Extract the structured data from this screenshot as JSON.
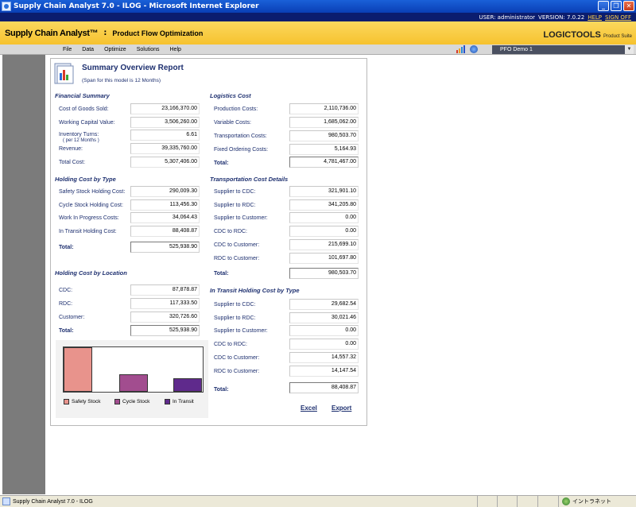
{
  "window": {
    "title": "Supply Chain Analyst 7.0 - ILOG - Microsoft Internet Explorer",
    "buttons": [
      "_",
      "❐",
      "✕"
    ]
  },
  "userbar": {
    "user_text": "USER: administrator",
    "version_text": "VERSION: 7.0.22",
    "help": "HELP",
    "signoff": "SIGN OFF"
  },
  "banner": {
    "brand": "Supply Chain Analyst™",
    "separator": ":",
    "product": "Product Flow Optimization",
    "logo": "LOGICTOOLS",
    "logo_suffix": "Product Suite"
  },
  "menu": {
    "items": [
      "File",
      "Data",
      "Optimize",
      "Solutions",
      "Help"
    ],
    "scenario": "PFO Demo 1"
  },
  "report": {
    "title": "Summary Overview Report",
    "span": "(Span for this model is 12 Months)",
    "financial": {
      "heading": "Financial Summary",
      "rows": [
        {
          "label": "Cost of Goods Sold:",
          "value": "23,166,370.00"
        },
        {
          "label": "Working Capital Value:",
          "value": "3,506,260.00"
        },
        {
          "label": "Inventory Turns:",
          "sub": "( per 12 Months )",
          "value": "6.61"
        },
        {
          "label": "Revenue:",
          "value": "39,335,760.00"
        },
        {
          "label": "Total Cost:",
          "value": "5,307,406.00"
        }
      ]
    },
    "logistics": {
      "heading": "Logistics Cost",
      "rows": [
        {
          "label": "Production Costs:",
          "value": "2,110,736.00"
        },
        {
          "label": "Variable Costs:",
          "value": "1,685,062.00"
        },
        {
          "label": "Transportation Costs:",
          "value": "980,503.70"
        },
        {
          "label": "Fixed Ordering Costs:",
          "value": "5,164.93"
        }
      ],
      "total_label": "Total:",
      "total": "4,781,467.00"
    },
    "holding_type": {
      "heading": "Holding Cost by Type",
      "rows": [
        {
          "label": "Safety Stock Holding Cost:",
          "value": "290,009.30"
        },
        {
          "label": "Cycle Stock Holding Cost:",
          "value": "113,456.30"
        },
        {
          "label": "Work In Progress Costs:",
          "value": "34,064.43"
        },
        {
          "label": "In Transit Holding Cost:",
          "value": "88,408.87"
        }
      ],
      "total_label": "Total:",
      "total": "525,938.90"
    },
    "transport": {
      "heading": "Transportation Cost Details",
      "rows": [
        {
          "label": "Supplier to CDC:",
          "value": "321,901.10"
        },
        {
          "label": "Supplier to RDC:",
          "value": "341,205.80"
        },
        {
          "label": "Supplier to Customer:",
          "value": "0.00"
        },
        {
          "label": "CDC to RDC:",
          "value": "0.00"
        },
        {
          "label": "CDC to Customer:",
          "value": "215,699.10"
        },
        {
          "label": "RDC to Customer:",
          "value": "101,697.80"
        }
      ],
      "total_label": "Total:",
      "total": "980,503.70"
    },
    "holding_location": {
      "heading": "Holding Cost by Location",
      "rows": [
        {
          "label": "CDC:",
          "value": "87,878.87"
        },
        {
          "label": "RDC:",
          "value": "117,333.50"
        },
        {
          "label": "Customer:",
          "value": "320,726.60"
        }
      ],
      "total_label": "Total:",
      "total": "525,938.90"
    },
    "in_transit": {
      "heading": "In Transit Holding Cost by Type",
      "rows": [
        {
          "label": "Supplier to CDC:",
          "value": "29,682.54"
        },
        {
          "label": "Supplier to RDC:",
          "value": "30,021.46"
        },
        {
          "label": "Supplier to Customer:",
          "value": "0.00"
        },
        {
          "label": "CDC to RDC:",
          "value": "0.00"
        },
        {
          "label": "CDC to Customer:",
          "value": "14,557.32"
        },
        {
          "label": "RDC to Customer:",
          "value": "14,147.54"
        }
      ],
      "total_label": "Total:",
      "total": "88,408.87"
    },
    "actions": {
      "excel": "Excel",
      "export": "Export"
    }
  },
  "chart_data": {
    "type": "bar",
    "categories": [
      "Safety Stock",
      "Cycle Stock",
      "In Transit"
    ],
    "values": [
      290009.3,
      113456.3,
      88408.87
    ],
    "colors": [
      "#e8938c",
      "#a24d8f",
      "#5f2a8c"
    ],
    "legend_position": "bottom"
  },
  "statusbar": {
    "text": "Supply Chain Analyst 7.0 - ILOG",
    "zone": "イントラネット"
  }
}
